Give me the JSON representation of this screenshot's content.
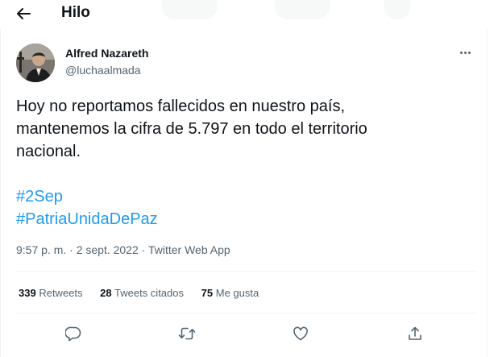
{
  "header": {
    "title": "Hilo",
    "back_icon": "arrow-left-icon"
  },
  "author": {
    "name": "Alfred Nazareth",
    "handle": "@luchaalmada"
  },
  "tweet": {
    "text_lines": [
      "Hoy no reportamos fallecidos en nuestro país,",
      "mantenemos la cifra de 5.797 en todo el territorio",
      "nacional."
    ],
    "hashtags": [
      "#2Sep",
      "#PatriaUnidaDePaz"
    ],
    "timestamp": "9:57 p. m. · 2 sept. 2022",
    "separator": " · ",
    "source": "Twitter Web App"
  },
  "stats": {
    "retweets": {
      "count": "339",
      "label": "Retweets"
    },
    "quotes": {
      "count": "28",
      "label": "Tweets citados"
    },
    "likes": {
      "count": "75",
      "label": "Me gusta"
    }
  },
  "actions": {
    "reply_icon": "reply-icon",
    "retweet_icon": "retweet-icon",
    "like_icon": "heart-icon",
    "share_icon": "share-icon"
  },
  "colors": {
    "link": "#1d9bf0",
    "text": "#0f1419",
    "secondary": "#536471",
    "border": "#eff3f4"
  }
}
